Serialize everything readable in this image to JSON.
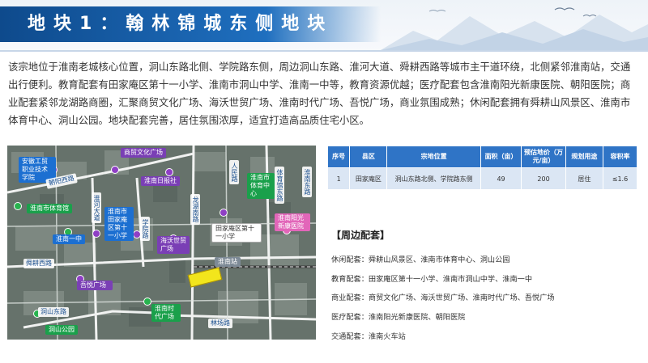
{
  "header": {
    "title": "地块1：翰林锦城东侧地块",
    "accent_color": "#0e4a8c"
  },
  "intro": "该宗地位于淮南老城核心位置，洞山东路北侧、学院路东侧，周边洞山东路、淮河大道、舜耕西路等城市主干道环绕，北侧紧邻淮南站，交通出行便利。教育配套有田家庵区第十一小学、淮南市洞山中学、淮南一中等，教育资源优越；医疗配套包含淮南阳光新康医院、朝阳医院；商业配套紧邻龙湖路商圈，汇聚商贸文化广场、海沃世贸广场、淮南时代广场、吾悦广场，商业氛围成熟；休闲配套拥有舜耕山风景区、淮南市体育中心、洞山公园。地块配套完善，居住氛围浓厚，适宜打造高品质住宅小区。",
  "map": {
    "labels": {
      "anjiao": "安徽工贸职业技术学院",
      "shangmao": "商贸文化广场",
      "chaoyang_rd": "朝阳西路",
      "tiyuguan": "淮南市体育馆",
      "huainan_yizhong": "淮南一中",
      "shungeng_rd": "舜耕西路",
      "dongshan_rd": "洞山东路",
      "dongshan_park": "洞山公园",
      "huaihe_ave": "淮河大道",
      "xiao11": "淮南市田家庵区第十一小学",
      "xueyuan_rd": "学院路",
      "zhiguang": "淮南日报社",
      "haiwo": "海沃世贸广场",
      "wuyue": "吾悦广场",
      "longhu_rd": "龙湖南路",
      "dongshan_mid": "淮南市洞山中学",
      "tianjia_shiyi": "田家庵区第十一小学",
      "renmin_rd": "人民路",
      "tiyu_zhongxin": "淮南市体育中心",
      "tiyuguan_rd": "体育馆东路",
      "huaihe_east": "淮南东路",
      "yangguang": "淮南阳光新康医院",
      "station": "淮南站",
      "shidai": "淮南时代广场",
      "lintong_rd": "林场路",
      "dongshan_s": "洞山东路"
    }
  },
  "table": {
    "headers": [
      "序号",
      "县区",
      "宗地位置",
      "面积（亩）",
      "预估地价（万元/亩）",
      "规划用途",
      "容积率"
    ],
    "rows": [
      [
        "1",
        "田家庵区",
        "洞山东路北侧、学院路东侧",
        "49",
        "200",
        "居住",
        "≤1.6"
      ]
    ]
  },
  "amenities": {
    "title": "【周边配套】",
    "items": [
      "休闲配套：舜耕山风景区、淮南市体育中心、洞山公园",
      "教育配套：田家庵区第十一小学、淮南市洞山中学、淮南一中",
      "商业配套：商贸文化广场、海沃世贸广场、淮南时代广场、吾悦广场",
      "医疗配套：淮南阳光新康医院、朝阳医院",
      "交通配套：淮南火车站"
    ]
  }
}
